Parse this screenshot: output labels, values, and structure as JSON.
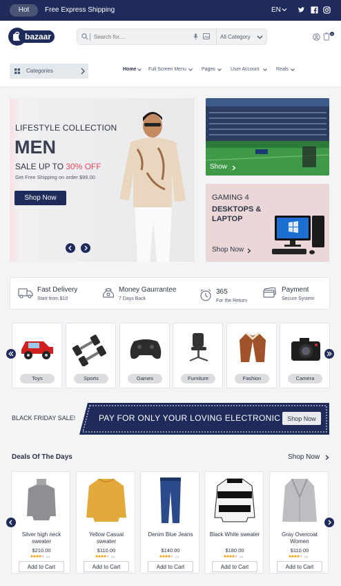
{
  "topbar": {
    "badge": "Hot",
    "promo": "Free Express Shipping",
    "language": "EN",
    "social_icons": [
      "twitter-icon",
      "facebook-icon",
      "instagram-icon"
    ]
  },
  "header": {
    "logo_text": "bazaar",
    "search_placeholder": "Search for....",
    "category_select": "All Category",
    "cart_count": "0"
  },
  "nav": {
    "categories_label": "Categories",
    "links": [
      "Home",
      "Full Screen Menu",
      "Pages",
      "User Account",
      "Reals"
    ]
  },
  "hero": {
    "kicker": "LIFESTYLE COLLECTION",
    "title": "MEN",
    "sale_prefix": "SALE UP TO ",
    "sale_percent": "30% OFF",
    "shipping_note": "Get Free Shipping on order $99.00",
    "cta": "Shop Now"
  },
  "side_banners": {
    "stadium_link": "Show",
    "gaming_line1": "GAMING 4",
    "gaming_line2": "DESKTOPS & LAPTOP",
    "gaming_link": "Shop Now"
  },
  "services": [
    {
      "title": "Fast Delivery",
      "subtitle": "Start from $10",
      "icon": "truck-icon"
    },
    {
      "title": "Money Gaurrantee",
      "subtitle": "7 Days Back",
      "icon": "money-bag-icon"
    },
    {
      "title": "365",
      "subtitle": "For the Return",
      "icon": "alarm-clock-icon"
    },
    {
      "title": "Payment",
      "subtitle": "Secure System",
      "icon": "credit-card-icon"
    }
  ],
  "categories": [
    "Toys",
    "Sports",
    "Games",
    "Furniture",
    "Fashion",
    "Camera"
  ],
  "promo_banner": {
    "left": "BLACK FRIDAY SALE!",
    "middle": "PAY  FOR ONLY YOUR LOVING ELECTRONIC",
    "button": "Shop Now"
  },
  "deals": {
    "title": "Deals Of The Days",
    "more": "Shop Now",
    "add_to_cart": "Add to Cart",
    "products": [
      {
        "name": "Silver high neck sweater",
        "price": "$210.00",
        "rating_count": "(0)"
      },
      {
        "name": "Yellow Casual sweater",
        "price": "$110.00",
        "rating_count": "(0)"
      },
      {
        "name": "Denim Blue Jeans",
        "price": "$140.00",
        "rating_count": "(0)"
      },
      {
        "name": "Black White sweater",
        "price": "$180.00",
        "rating_count": "(0)"
      },
      {
        "name": "Gray Overcoat Women",
        "price": "$110.00",
        "rating_count": "(0)"
      }
    ]
  },
  "colors": {
    "navy": "#1f2b5a",
    "accent_red": "#e94560",
    "star": "#f5a623"
  }
}
